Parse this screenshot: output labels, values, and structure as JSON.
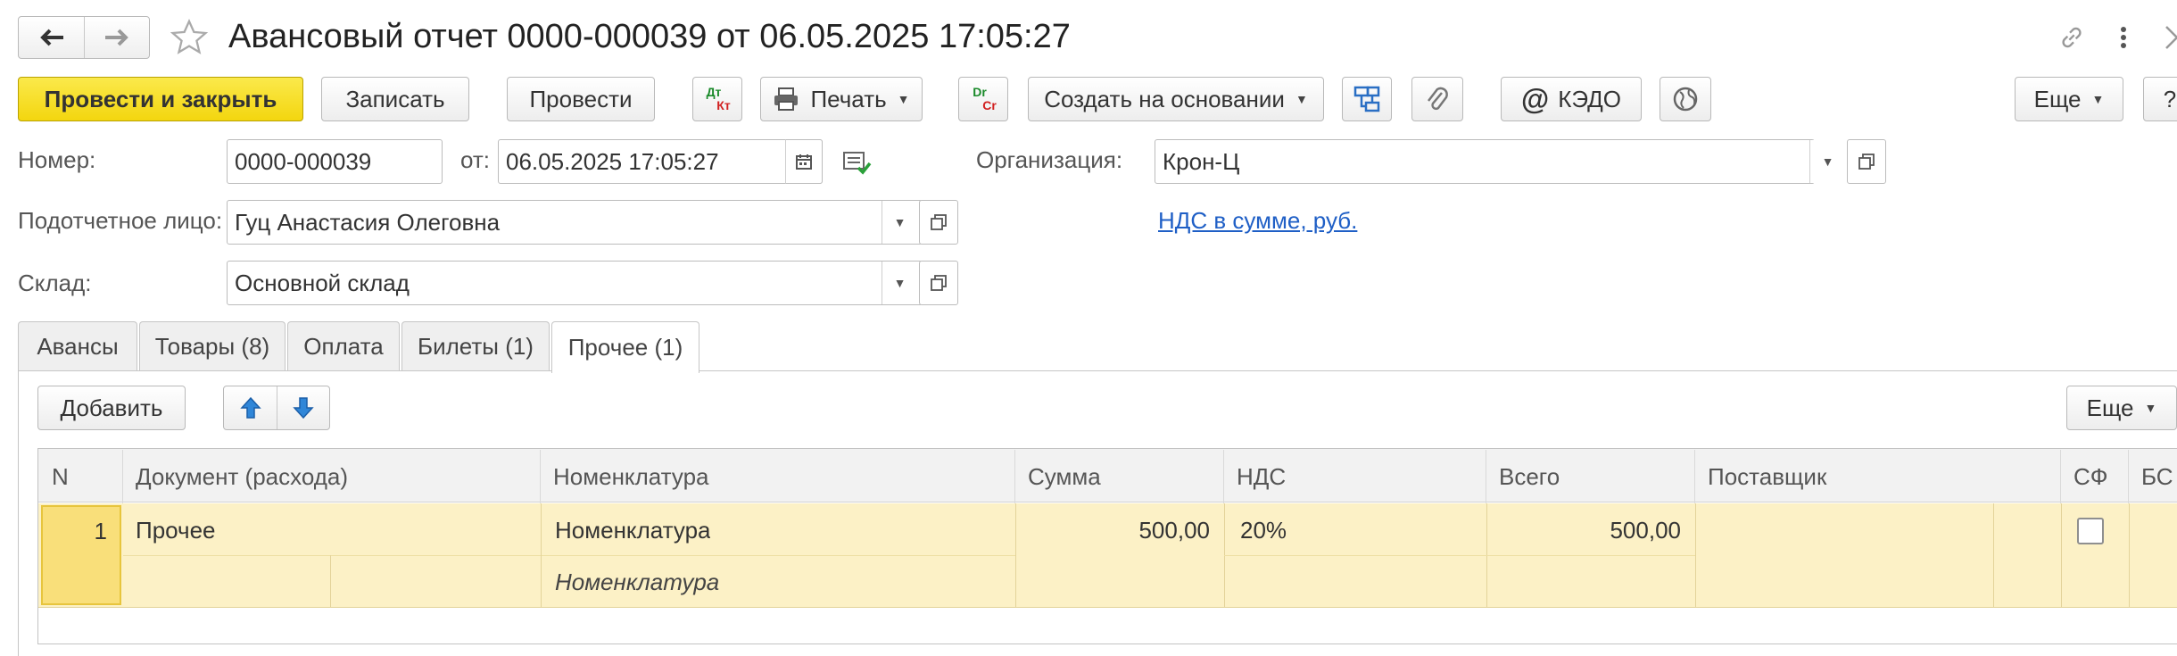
{
  "header": {
    "title": "Авансовый отчет 0000-000039 от 06.05.2025 17:05:27",
    "nav_back": "back-arrow",
    "nav_forward": "forward-arrow",
    "star": "star-icon",
    "link": "link-icon",
    "menu": "more-vertical-icon"
  },
  "toolbar": {
    "post_close": "Провести и закрыть",
    "save": "Записать",
    "post": "Провести",
    "dtkt_top": "Дт",
    "dtkt_bottom": "Кт",
    "print": "Печать",
    "drcr_top": "Dr",
    "drcr_bottom": "Cr",
    "create_basis": "Создать на основании",
    "kedo": "КЭДО",
    "more": "Еще",
    "help": "?"
  },
  "form": {
    "number_label": "Номер:",
    "number_value": "0000-000039",
    "from_label": "от:",
    "date_value": "06.05.2025 17:05:27",
    "org_label": "Организация:",
    "org_value": "Крон-Ц",
    "person_label": "Подотчетное лицо:",
    "person_value": "Гуц Анастасия Олеговна",
    "vat_link": "НДС в сумме, руб.",
    "warehouse_label": "Склад:",
    "warehouse_value": "Основной склад"
  },
  "tabs": [
    {
      "label": "Авансы"
    },
    {
      "label": "Товары (8)"
    },
    {
      "label": "Оплата"
    },
    {
      "label": "Билеты (1)"
    },
    {
      "label": "Прочее (1)"
    }
  ],
  "table_toolbar": {
    "add": "Добавить",
    "more": "Еще"
  },
  "table": {
    "columns": [
      "N",
      "Документ (расхода)",
      "Номенклатура",
      "Сумма",
      "НДС",
      "Всего",
      "Поставщик",
      "СФ",
      "БС"
    ],
    "rows": [
      {
        "n": "1",
        "document": "Прочее",
        "nomenclature": "Номенклатура",
        "nomenclature_sub": "Номенклатура",
        "sum": "500,00",
        "vat": "20%",
        "total": "500,00",
        "supplier": "",
        "sf_checked": false
      }
    ]
  },
  "colors": {
    "primary_yellow": "#f5d91b",
    "row_selected": "#fcf1c6",
    "row_cell_focus": "#f9df7a",
    "link_blue": "#1f5fc6"
  }
}
